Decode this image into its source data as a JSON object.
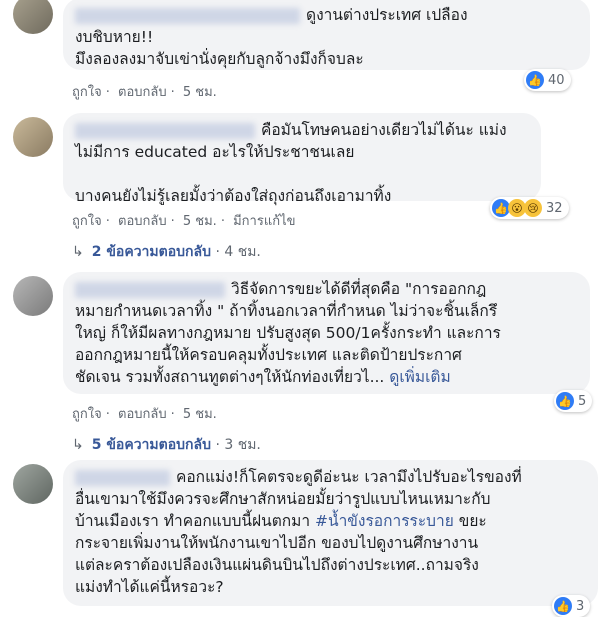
{
  "comments": [
    {
      "text_line1": "ดูงานต่างประเทศ เปลือง",
      "text_rest": "งบชิบหาย!!\nมึงลองลงมาจับเข่านั่งคุยกับลูกจ้างมึงก็จบละ",
      "like_label": "ถูกใจ",
      "reply_label": "ตอบกลับ",
      "time": "5 ชม.",
      "reaction_count": "40"
    },
    {
      "text_line1": "คือมันโทษคนอย่างเดียวไม่ได้นะ แม่ง",
      "text_rest": "ไม่มีการ educated อะไรให้ประชาชนเลย\n\nบางคนยังไม่รู้เลยมั้งว่าต้องใส่ถุงก่อนถึงเอามาทิ้ง",
      "like_label": "ถูกใจ",
      "reply_label": "ตอบกลับ",
      "time": "5 ชม.",
      "edited": "มีการแก้ไข",
      "reaction_count": "32",
      "replies_label": "2 ข้อความตอบกลับ",
      "replies_time": "4 ชม."
    },
    {
      "text_line1": "วิธีจัดการขยะได้ดีที่สุดคือ \"การออกกฎ",
      "text_rest": "หมายกำหนดเวลาทิ้ง \" ถ้าทิ้งนอกเวลาที่กำหนด ไม่ว่าจะชิ้นเล็กรึ\nใหญ่ ก็ให้มีผลทางกฎหมาย ปรับสูงสุด 500/1ครั้งกระทำ และการ\nออกกฎหมายนี้ให้ครอบคลุมทั้งประเทศ และติดป้ายประกาศ\nชัดเจน รวมทั้งสถานทูตต่างๆให้นักท่องเที่ยวไ...",
      "see_more": "ดูเพิ่มเติม",
      "like_label": "ถูกใจ",
      "reply_label": "ตอบกลับ",
      "time": "5 ชม.",
      "reaction_count": "5",
      "replies_label": "5 ข้อความตอบกลับ",
      "replies_time": "3 ชม."
    },
    {
      "text_line1": "คอกแม่ง!ก็โคตรจะดูดีอ่ะนะ เวลามึงไปรับอะไรของที่",
      "text_a": "อื่นเขามาใช้มึงควรจะศึกษาสักหน่อยมั้ยว่ารูปแบบไหนเหมาะกับ\nบ้านเมืองเรา ทำคอกแบบนี้ฝนตกมา ",
      "hashtag": "#น้ำขังรอการระบาย",
      "text_b": " ขยะ\nกระจายเพิ่มงานให้พนักงานเขาไปอีก ของบไปดูงานศึกษางาน\nแต่ละคราต้องเปลืองเงินแผ่นดินบินไปถึงต่างประเทศ..ถามจริง\nแม่งทำได้แค่นี้หรอวะ?",
      "reaction_count": "3"
    }
  ],
  "dot": "·",
  "icons": {
    "like": "thumbs-up-icon",
    "wow": "wow-face-icon",
    "sad": "sad-face-icon",
    "reply": "reply-arrow-icon"
  },
  "colors": {
    "link": "#385898",
    "bubble": "#f2f3f5",
    "like": "#2f7cf6"
  }
}
